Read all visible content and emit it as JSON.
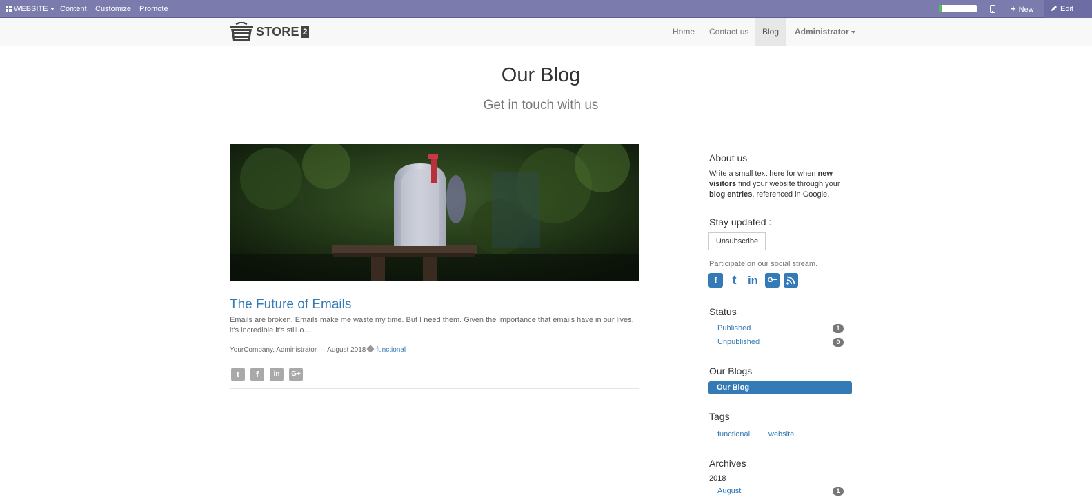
{
  "admin_bar": {
    "website_label": "WEBSITE",
    "content_label": "Content",
    "customize_label": "Customize",
    "promote_label": "Promote",
    "progress_percent": 8,
    "new_label": "New",
    "edit_label": "Edit",
    "icons": [
      "apps-grid-icon",
      "mobile-preview-icon",
      "plus-icon",
      "pencil-icon"
    ]
  },
  "navbar": {
    "logo_word": "STORE",
    "logo_number": "2",
    "links": [
      "Home",
      "Contact us",
      "Blog"
    ],
    "active_link": "Blog",
    "user_menu": "Administrator"
  },
  "header": {
    "title": "Our Blog",
    "subtitle": "Get in touch with us"
  },
  "post": {
    "title": "The Future of Emails",
    "teaser": "Emails are broken. Emails make me waste my time. But I need them. Given the importance that emails have in our lives, it's incredible it's still o...",
    "author_date": "YourCompany, Administrator — August 2018",
    "tag": "functional",
    "share_icons": [
      "twitter-icon",
      "facebook-icon",
      "linkedin-icon",
      "google-plus-icon"
    ]
  },
  "sidebar": {
    "about": {
      "heading": "About us",
      "text_1": "Write a small text here for when ",
      "bold_1": "new visitors",
      "text_2": " find your website through your ",
      "bold_2": "blog entries",
      "text_3": ", referenced in Google."
    },
    "stay_updated": {
      "heading": "Stay updated :",
      "button": "Unsubscribe"
    },
    "social": {
      "text": "Participate on our social stream.",
      "icons": [
        "facebook-icon",
        "twitter-icon",
        "linkedin-icon",
        "google-plus-icon",
        "rss-icon"
      ]
    },
    "status": {
      "heading": "Status",
      "items": [
        {
          "label": "Published",
          "count": "1"
        },
        {
          "label": "Unpublished",
          "count": "0"
        }
      ]
    },
    "blogs": {
      "heading": "Our Blogs",
      "active": "Our Blog"
    },
    "tags": {
      "heading": "Tags",
      "items": [
        "functional",
        "website"
      ]
    },
    "archives": {
      "heading": "Archives",
      "year": "2018",
      "months": [
        {
          "label": "August",
          "count": "1"
        }
      ]
    }
  },
  "colors": {
    "admin_bar": "#7c7bad",
    "link": "#337ab7",
    "badge": "#777777",
    "share_icon": "#a9a9a9"
  }
}
